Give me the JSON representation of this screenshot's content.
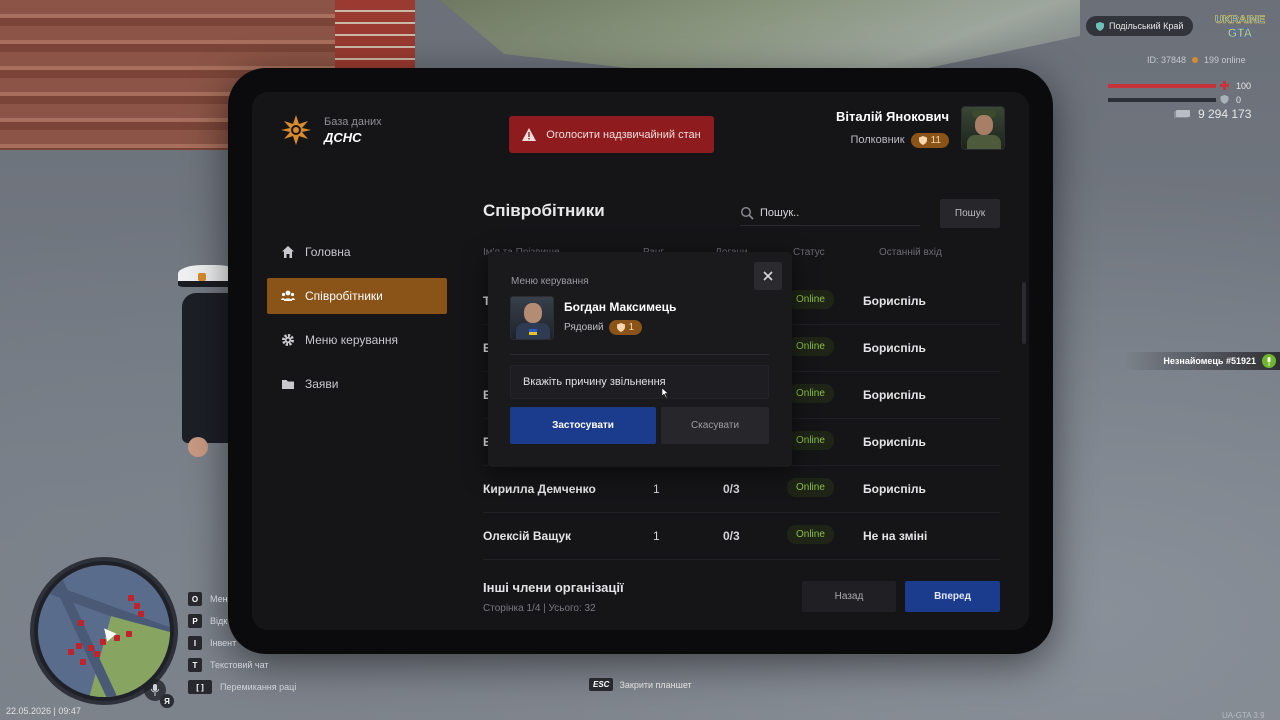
{
  "app": {
    "org_subtitle": "База даних",
    "org_name": "ДСНС",
    "emergency_button": "Оголосити надзвичайний стан"
  },
  "user": {
    "name": "Віталій Янокович",
    "rank": "Полковник",
    "level": "11"
  },
  "nav": [
    {
      "label": "Головна",
      "icon": "home-icon"
    },
    {
      "label": "Співробітники",
      "icon": "users-icon",
      "active": true
    },
    {
      "label": "Меню керування",
      "icon": "gear-icon"
    },
    {
      "label": "Заяви",
      "icon": "folder-icon"
    }
  ],
  "employees": {
    "title": "Співробітники",
    "search_placeholder": "Пошук..",
    "search_button": "Пошук",
    "columns": [
      "Ім'я та Прізвище",
      "Ранг",
      "Догани",
      "Статус",
      "Останній вхід"
    ],
    "rows": [
      {
        "name": "Т",
        "level": "",
        "warns": "",
        "status": "Online",
        "last": "Бориспіль"
      },
      {
        "name": "Е",
        "level": "",
        "warns": "",
        "status": "Online",
        "last": "Бориспіль"
      },
      {
        "name": "Е",
        "level": "",
        "warns": "",
        "status": "Online",
        "last": "Бориспіль"
      },
      {
        "name": "Е",
        "level": "",
        "warns": "",
        "status": "Online",
        "last": "Бориспіль"
      },
      {
        "name": "Кирилла Демченко",
        "level": "1",
        "warns": "0/3",
        "status": "Online",
        "last": "Бориспіль"
      },
      {
        "name": "Олексій Ващук",
        "level": "1",
        "warns": "0/3",
        "status": "Online",
        "last": "Не на зміні"
      }
    ],
    "others_title": "Інші члени організації",
    "pagination": "Сторінка 1/4 | Усього: 32",
    "back_button": "Назад",
    "forward_button": "Вперед"
  },
  "modal": {
    "title": "Меню керування",
    "employee_name": "Богдан Максимець",
    "employee_rank": "Рядовий",
    "employee_level": "1",
    "reason_placeholder": "Вкажіть причину звільнення",
    "apply_button": "Застосувати",
    "cancel_button": "Скасувати"
  },
  "hud": {
    "region": "Подільський Край",
    "game_logo": "UKRAINE GTA",
    "player_id": "ID: 37848",
    "online": "199 online",
    "health": "100",
    "armor": "0",
    "money": "9 294 173",
    "stranger": "Незнайомець #51921",
    "keys": [
      {
        "key": "O",
        "label": "Мен"
      },
      {
        "key": "P",
        "label": "Відк"
      },
      {
        "key": "I",
        "label": "Інвент"
      },
      {
        "key": "T",
        "label": "Текстовий чат"
      },
      {
        "key": "[ ]",
        "label": "Перемикання раці"
      }
    ],
    "lang": "Я",
    "datetime": "22.05.2026 | 09:47",
    "esc_key": "ESC",
    "esc_hint": "Закрити планшет",
    "version": "UA-GTA 3.9"
  },
  "colors": {
    "accent_orange": "#8a5317",
    "accent_blue": "#1b3b8d",
    "danger_red": "#8e1b1d",
    "online_green": "#8bbf49"
  }
}
